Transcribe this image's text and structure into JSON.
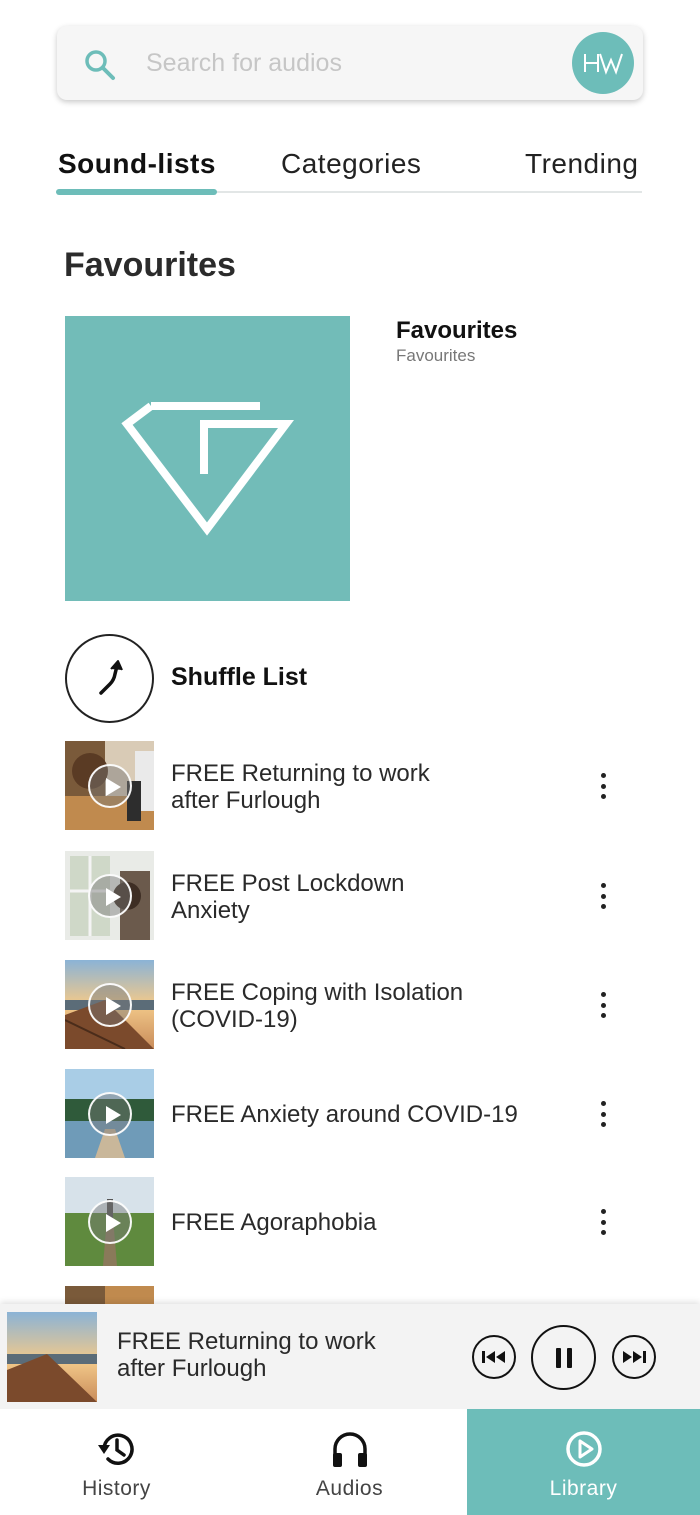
{
  "search": {
    "placeholder": "Search for audios"
  },
  "logo": {
    "text": "HW"
  },
  "tabs": [
    {
      "label": "Sound-lists",
      "active": true
    },
    {
      "label": "Categories",
      "active": false
    },
    {
      "label": "Trending",
      "active": false
    }
  ],
  "section": {
    "title": "Favourites"
  },
  "playlist": {
    "title": "Favourites",
    "subtitle": "Favourites"
  },
  "shuffle": {
    "label": "Shuffle List"
  },
  "tracks": [
    {
      "title": "FREE Returning to work after Furlough",
      "thumb": "office-desk"
    },
    {
      "title": "FREE Post Lockdown Anxiety",
      "thumb": "window-figure"
    },
    {
      "title": "FREE Coping with Isolation (COVID-19)",
      "thumb": "pier-sunset"
    },
    {
      "title": "FREE Anxiety around COVID-19",
      "thumb": "lake-jetty"
    },
    {
      "title": "FREE Agoraphobia",
      "thumb": "grass-path"
    }
  ],
  "now_playing": {
    "title": "FREE Returning to work after Furlough"
  },
  "nav": [
    {
      "label": "History",
      "icon": "history-icon",
      "active": false
    },
    {
      "label": "Audios",
      "icon": "headphones-icon",
      "active": false
    },
    {
      "label": "Library",
      "icon": "play-circle-icon",
      "active": true
    }
  ],
  "colors": {
    "accent": "#6dbdb9",
    "cover": "#72bcb8"
  }
}
